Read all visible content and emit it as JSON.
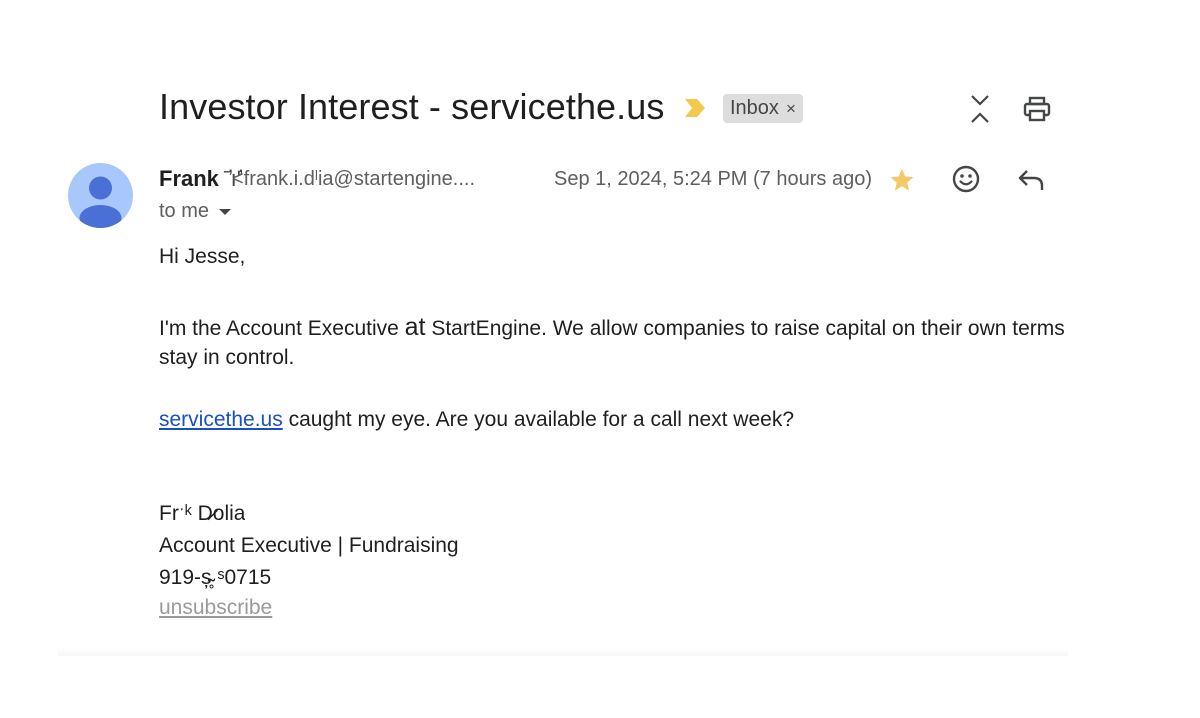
{
  "email": {
    "subject": "Investor Interest - servicethe.us",
    "label_chip": "Inbox",
    "label_remove": "×",
    "sender_name": "Frank",
    "sender_name_tail": " ˉ̓ıʹ̕",
    "sender_email": "<frank.i.dˡia@startengine....",
    "date": "Sep 1, 2024, 5:24 PM (7 hours ago)",
    "recipient": "to me"
  },
  "body": {
    "greeting": "Hi Jesse,",
    "para1_part1": "I'm the Account Executive ",
    "para1_at": "at",
    "para1_part2": " StartEngine. We allow companies to raise capital on their own terms",
    "para1_line2": "stay in control.",
    "link": "servicethe.us",
    "para2_rest": " caught my eye. Are you available for a call next week?",
    "sig_name": "Frˑᵏ D̷olia",
    "sig_title": "Account Executive | Fundraising",
    "sig_phone": "919-ș̴̥ ˢ0715",
    "unsubscribe": "unsubscribe"
  },
  "icons": {
    "importance": "importance-marker-icon",
    "collapse": "collapse-all-icon",
    "print": "print-icon",
    "avatar": "default-avatar-icon",
    "star": "star-icon",
    "emoji": "add-reaction-icon",
    "reply": "reply-icon",
    "dropdown": "chevron-down-icon"
  },
  "colors": {
    "importance": "#f2c94c",
    "star": "#f4c968",
    "avatar_bg": "#a8c7fa",
    "avatar_fg": "#4a6fd6",
    "link": "#1a4fc4",
    "chip_bg": "#dddddd"
  }
}
